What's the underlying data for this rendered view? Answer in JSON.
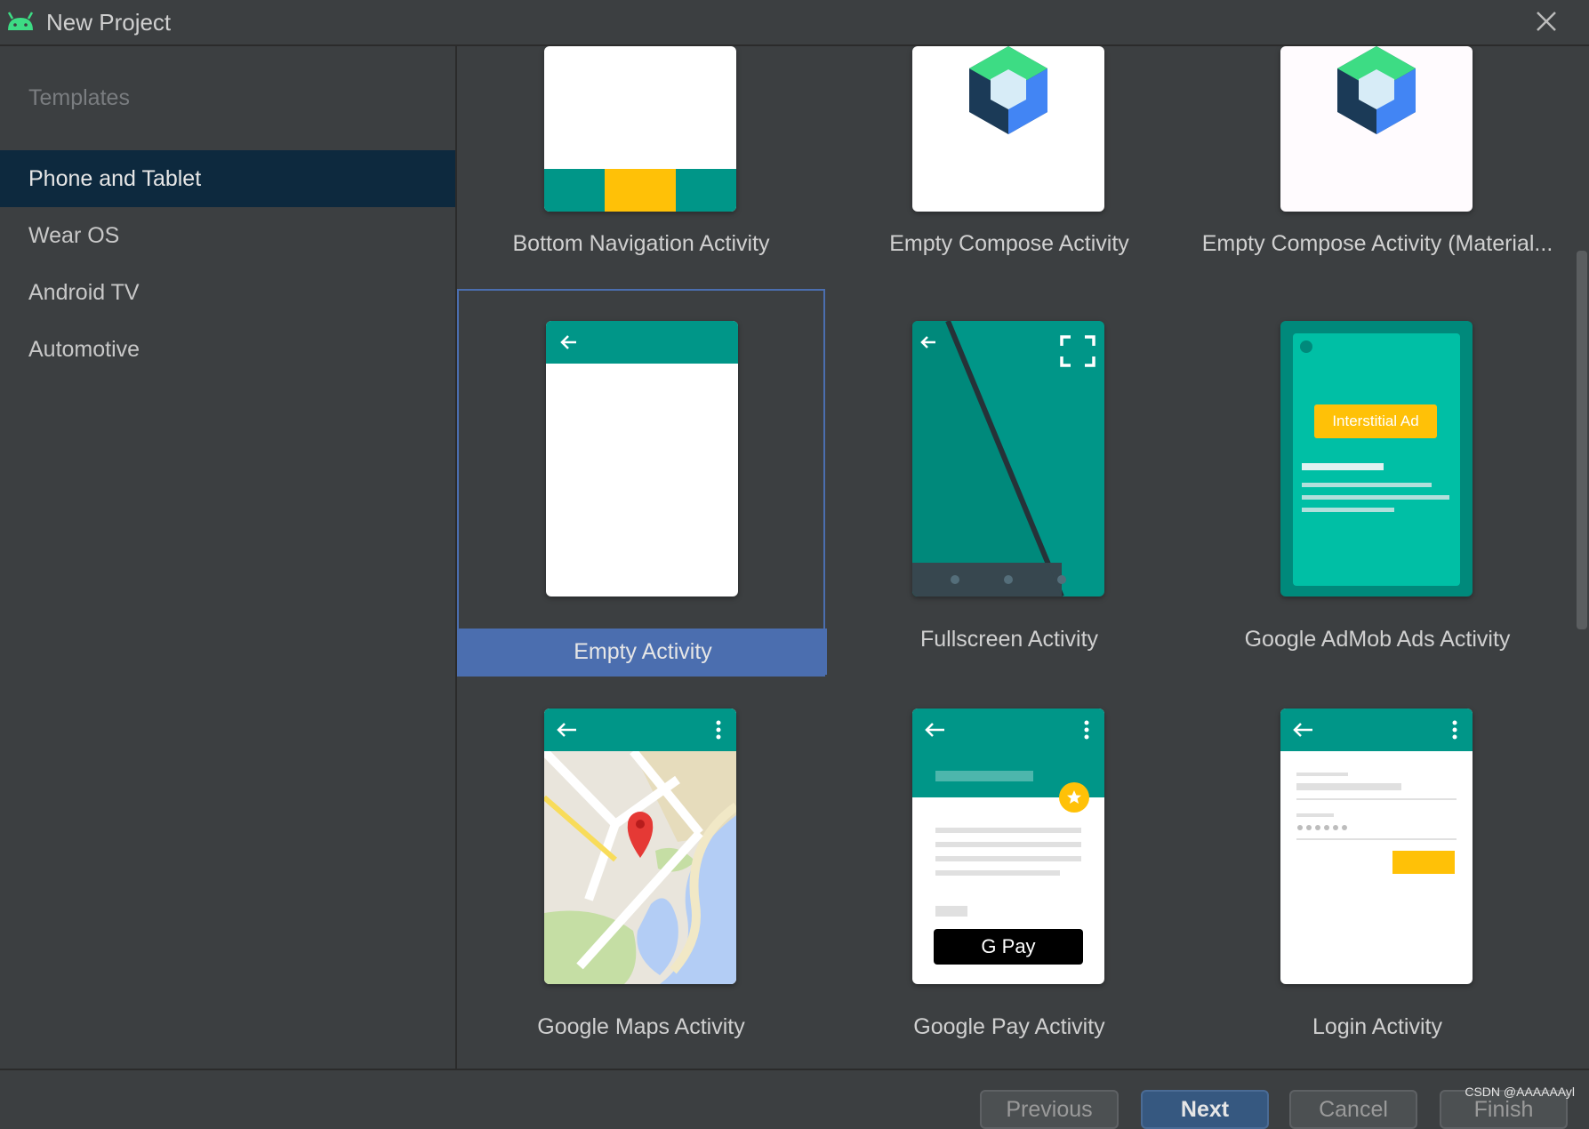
{
  "window": {
    "title": "New Project",
    "close_icon": "close-icon",
    "app_icon": "android-icon"
  },
  "sidebar": {
    "section_label": "Templates",
    "items": [
      {
        "label": "Phone and Tablet",
        "selected": true
      },
      {
        "label": "Wear OS"
      },
      {
        "label": "Android TV"
      },
      {
        "label": "Automotive"
      }
    ]
  },
  "templates": [
    {
      "label": "Bottom Navigation Activity"
    },
    {
      "label": "Empty Compose Activity"
    },
    {
      "label": "Empty Compose Activity (Material..."
    },
    {
      "label": "Empty Activity",
      "selected": true
    },
    {
      "label": "Fullscreen Activity"
    },
    {
      "label": "Google AdMob Ads Activity",
      "badge": "Interstitial Ad"
    },
    {
      "label": "Google Maps Activity"
    },
    {
      "label": "Google Pay Activity",
      "pay_button": "G Pay"
    },
    {
      "label": "Login Activity"
    }
  ],
  "footer": {
    "buttons": [
      {
        "label": "Previous"
      },
      {
        "label": "Next",
        "primary": true
      },
      {
        "label": "Cancel"
      },
      {
        "label": "Finish"
      }
    ],
    "watermark": "CSDN @AAAAAAyl"
  },
  "colors": {
    "teal": "#009688",
    "yellow": "#ffc107",
    "selection": "#4b6eaf",
    "sidebar_selected": "#0d293e"
  }
}
